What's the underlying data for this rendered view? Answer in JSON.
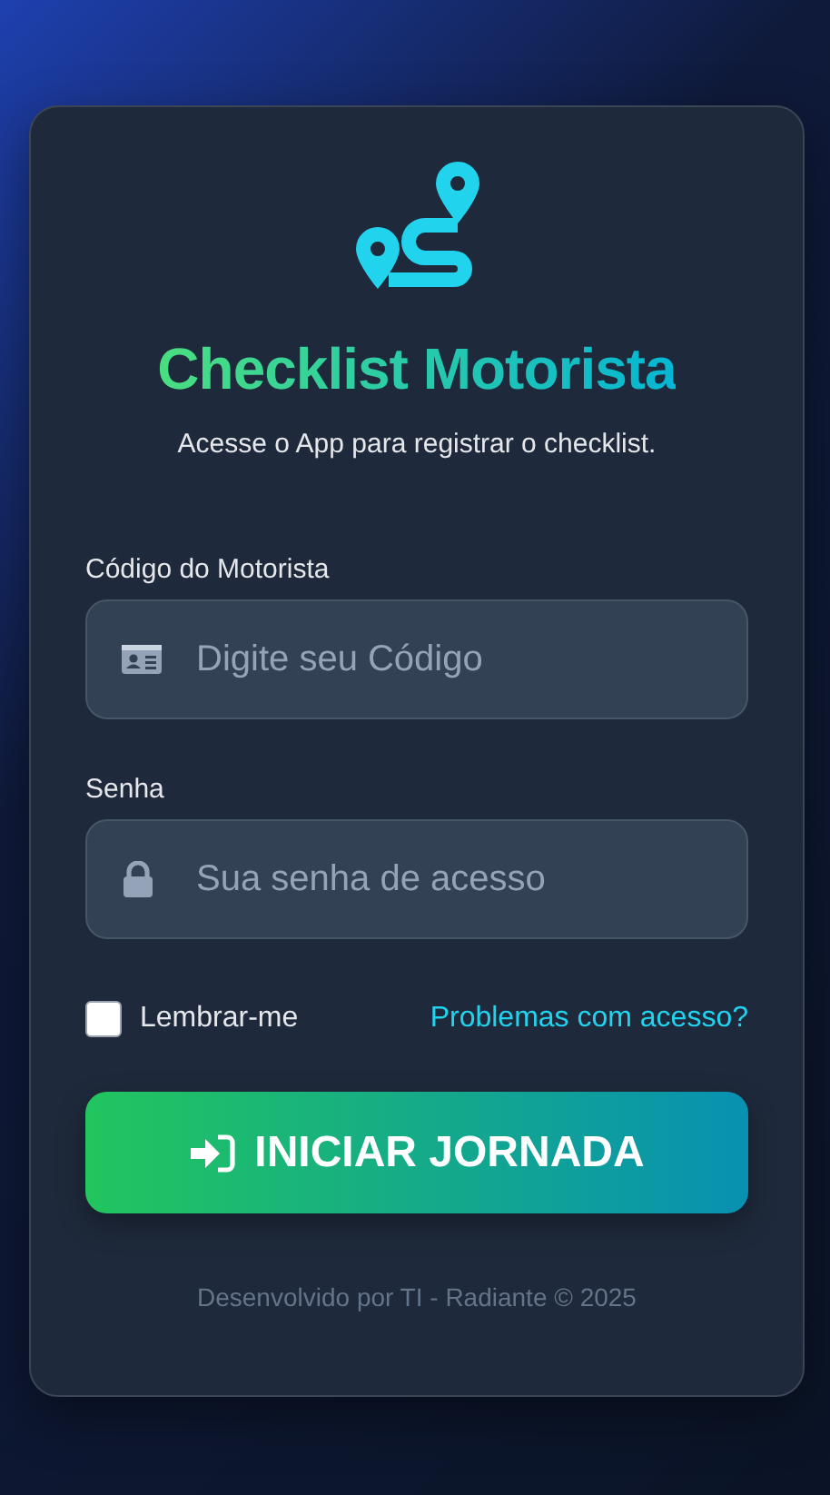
{
  "title": "Checklist Motorista",
  "subtitle": "Acesse o App para registrar o checklist.",
  "fields": [
    {
      "label": "Código do Motorista",
      "placeholder": "Digite seu Código",
      "kind": "id"
    },
    {
      "label": "Senha",
      "placeholder": "Sua senha de acesso",
      "kind": "password"
    }
  ],
  "remember": {
    "label": "Lembrar-me",
    "checked": false
  },
  "help_link": "Problemas com acesso?",
  "submit": "INICIAR JORNADA",
  "footer": "Desenvolvido por TI - Radiante © 2025"
}
